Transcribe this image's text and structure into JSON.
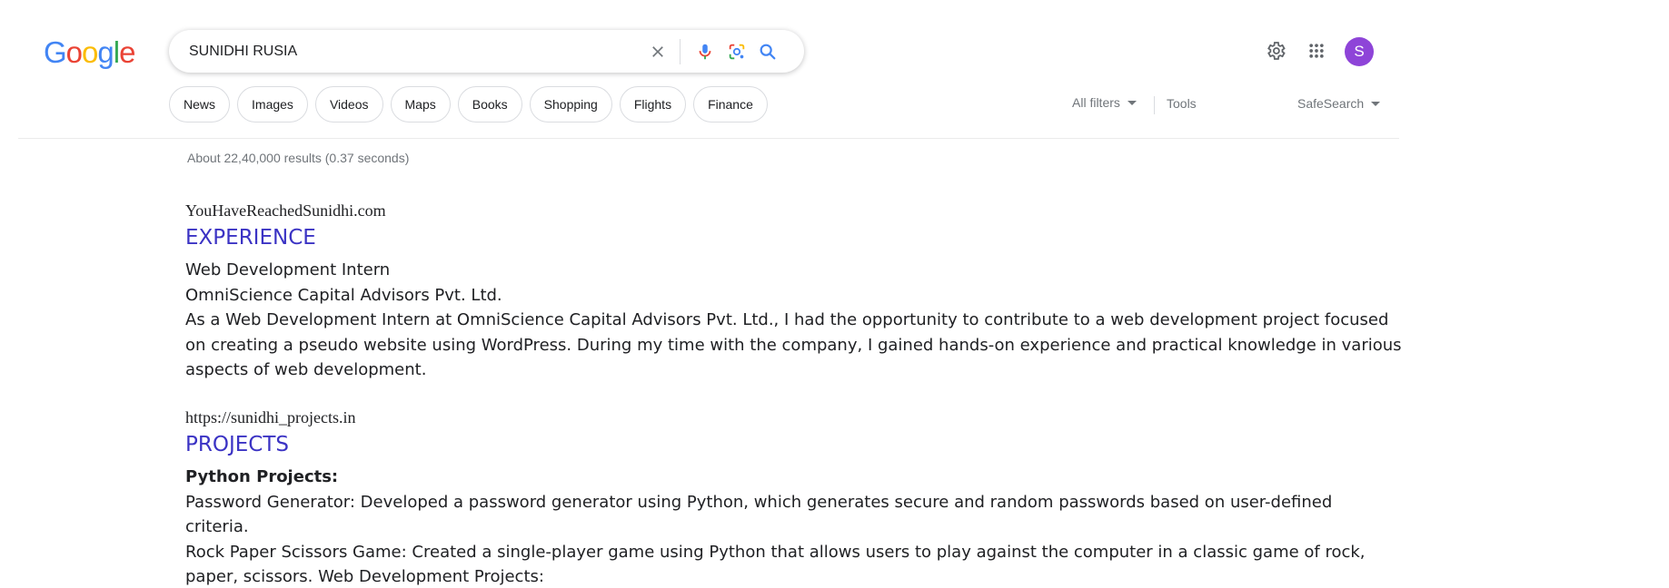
{
  "logo": {
    "letters": [
      {
        "char": "G",
        "color": "#4285F4"
      },
      {
        "char": "o",
        "color": "#EA4335"
      },
      {
        "char": "o",
        "color": "#FBBC05"
      },
      {
        "char": "g",
        "color": "#4285F4"
      },
      {
        "char": "l",
        "color": "#34A853"
      },
      {
        "char": "e",
        "color": "#EA4335"
      }
    ]
  },
  "search": {
    "query": "SUNIDHI RUSIA",
    "clear_icon": "close-icon",
    "voice_icon": "microphone-icon",
    "lens_icon": "camera-lens-icon",
    "search_icon": "search-icon"
  },
  "header": {
    "settings_icon": "gear-icon",
    "apps_icon": "grid-apps-icon",
    "avatar_letter": "S",
    "avatar_color": "#8e44d8"
  },
  "chips": [
    "News",
    "Images",
    "Videos",
    "Maps",
    "Books",
    "Shopping",
    "Flights",
    "Finance"
  ],
  "filters": {
    "all_filters": "All filters",
    "tools": "Tools",
    "safesearch": "SafeSearch"
  },
  "stats": "About 22,40,000 results (0.37 seconds)",
  "results": [
    {
      "site": "YouHaveReachedSunidhi.com",
      "title": "EXPERIENCE",
      "lines": [
        "Web Development Intern",
        "OmniScience Capital Advisors Pvt. Ltd.",
        "As a Web Development Intern at OmniScience Capital Advisors Pvt. Ltd., I had the opportunity to contribute to a web development project focused",
        "on creating a pseudo website using WordPress. During my time with the company, I gained hands-on experience and practical knowledge in various",
        "aspects of web development."
      ]
    },
    {
      "site": "https://sunidhi_projects.in",
      "title": "PROJECTS",
      "heading": "Python Projects:",
      "lines": [
        "Password Generator: Developed a password generator using Python, which generates secure and random passwords based on user-defined",
        "criteria.",
        "Rock Paper Scissors Game: Created a single-player game using Python that allows users to play against the computer in a classic game of rock,",
        "paper, scissors. Web Development Projects:"
      ]
    }
  ],
  "colors": {
    "link_title": "#3b33c4",
    "muted": "#70757a"
  }
}
